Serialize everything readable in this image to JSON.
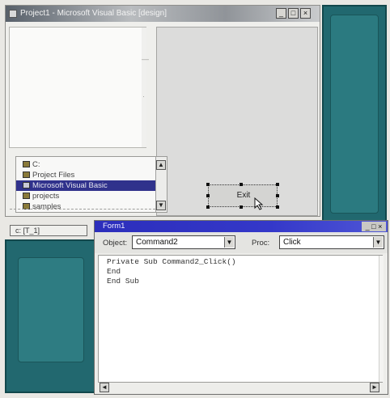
{
  "main_window": {
    "title": "Project1 - Microsoft Visual Basic [design]",
    "buttons": {
      "minimize": "_",
      "maximize": "□",
      "close": "×"
    }
  },
  "code_panel": {
    "scroll_marks": [
      "—",
      "·"
    ]
  },
  "form_designer": {
    "exit_button_label": "Exit"
  },
  "project_tree": {
    "items": [
      {
        "label": "C:"
      },
      {
        "label": "Project Files"
      },
      {
        "label": "Microsoft Visual Basic",
        "selected": true
      },
      {
        "label": "projects"
      },
      {
        "label": "samples"
      }
    ],
    "scroll_up": "▲",
    "scroll_down": "▼"
  },
  "drive_selector": {
    "value": "c: [T_1]"
  },
  "code_window": {
    "title": "Form1",
    "controls": "_ □ ×",
    "object_label": "Object:",
    "object_value": "Command2",
    "proc_label": "Proc:",
    "proc_value": "Click",
    "dropdown_arrow": "▼",
    "code_lines": [
      "Private Sub Command2_Click()",
      "End",
      "End Sub"
    ],
    "hscroll_left": "◄",
    "hscroll_right": "►"
  },
  "colors": {
    "teal_panel": "#21686f",
    "selection": "#30328c",
    "code_title_bar": "#2c2ebb"
  }
}
